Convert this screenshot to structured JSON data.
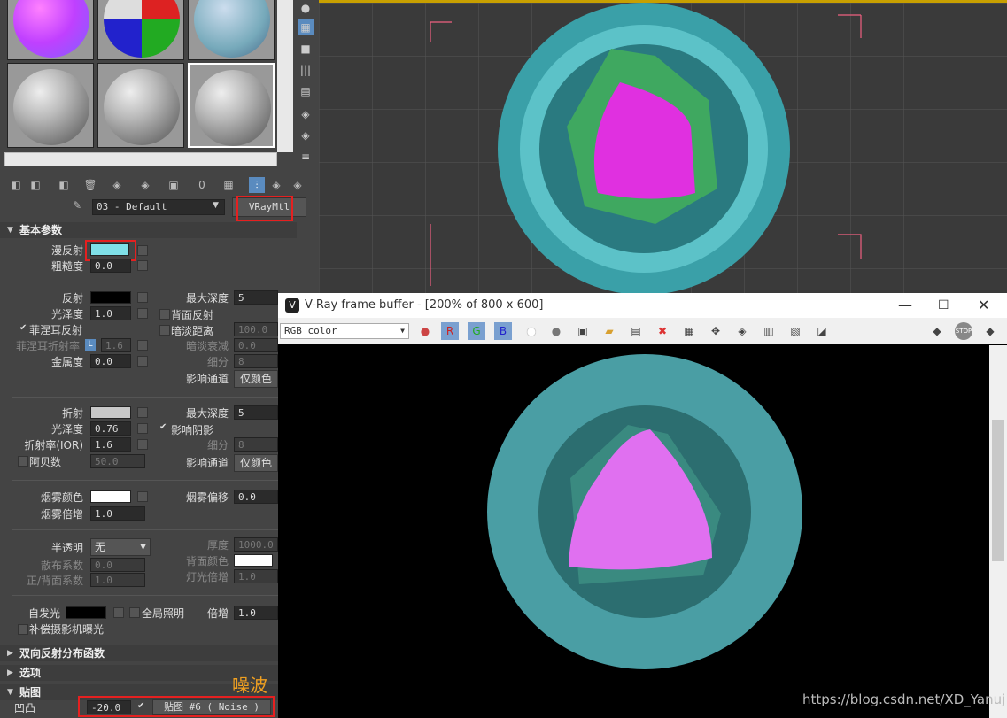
{
  "material_editor": {
    "material_name": "03 - Default",
    "material_type": "VRayMtl",
    "annotation": "噪波"
  },
  "basic_params": {
    "header": "基本参数",
    "diffuse_label": "漫反射",
    "diffuse_color": "#7fe0e8",
    "roughness_label": "粗糙度",
    "roughness_value": "0.0",
    "reflect_label": "反射",
    "reflect_color": "#000000",
    "glossiness_label": "光泽度",
    "glossiness_value": "1.0",
    "fresnel_label": "菲涅耳反射",
    "fresnel_ior_label": "菲涅耳折射率",
    "fresnel_ior_l": "L",
    "fresnel_ior_value": "1.6",
    "metalness_label": "金属度",
    "metalness_value": "0.0",
    "max_depth_label": "最大深度",
    "max_depth_value": "5",
    "back_reflect_label": "背面反射",
    "dim_distance_label": "暗淡距离",
    "dim_distance_value": "100.0",
    "dim_falloff_label": "暗淡衰减",
    "dim_falloff_value": "0.0",
    "subdivs_label": "细分",
    "subdivs_value": "8",
    "affect_channels_label": "影响通道",
    "affect_channels_value": "仅颜色",
    "refract_label": "折射",
    "refract_color": "#c8c8c8",
    "refr_gloss_label": "光泽度",
    "refr_gloss_value": "0.76",
    "ior_label": "折射率(IOR)",
    "ior_value": "1.6",
    "abbe_label": "阿贝数",
    "abbe_value": "50.0",
    "refr_max_depth_label": "最大深度",
    "refr_max_depth_value": "5",
    "affect_shadows_label": "影响阴影",
    "refr_subdivs_label": "细分",
    "refr_subdivs_value": "8",
    "refr_affect_channels_label": "影响通道",
    "refr_affect_channels_value": "仅颜色",
    "fog_color_label": "烟雾颜色",
    "fog_color": "#ffffff",
    "fog_multiplier_label": "烟雾倍增",
    "fog_multiplier_value": "1.0",
    "fog_bias_label": "烟雾偏移",
    "fog_bias_value": "0.0",
    "translucency_label": "半透明",
    "translucency_value": "无",
    "scatter_coeff_label": "散布系数",
    "scatter_coeff_value": "0.0",
    "fwd_back_coeff_label": "正/背面系数",
    "fwd_back_coeff_value": "1.0",
    "thickness_label": "厚度",
    "thickness_value": "1000.0",
    "back_color_label": "背面颜色",
    "light_mult_label": "灯光倍增",
    "light_mult_value": "1.0",
    "self_illum_label": "自发光",
    "gi_label": "全局照明",
    "mult_label": "倍增",
    "mult_value": "1.0",
    "compensate_label": "补偿摄影机曝光"
  },
  "rollouts": {
    "brdf": "双向反射分布函数",
    "options": "选项",
    "maps": "贴图"
  },
  "maps": {
    "bump_label": "凹凸",
    "bump_amount": "-20.0",
    "bump_map": "贴图 #6  ( Noise )"
  },
  "vfb": {
    "title": "V-Ray frame buffer - [200% of 800 x 600]",
    "channel": "RGB color",
    "r": "R",
    "g": "G",
    "b": "B"
  },
  "watermark": "https://blog.csdn.net/XD_Yanuj"
}
